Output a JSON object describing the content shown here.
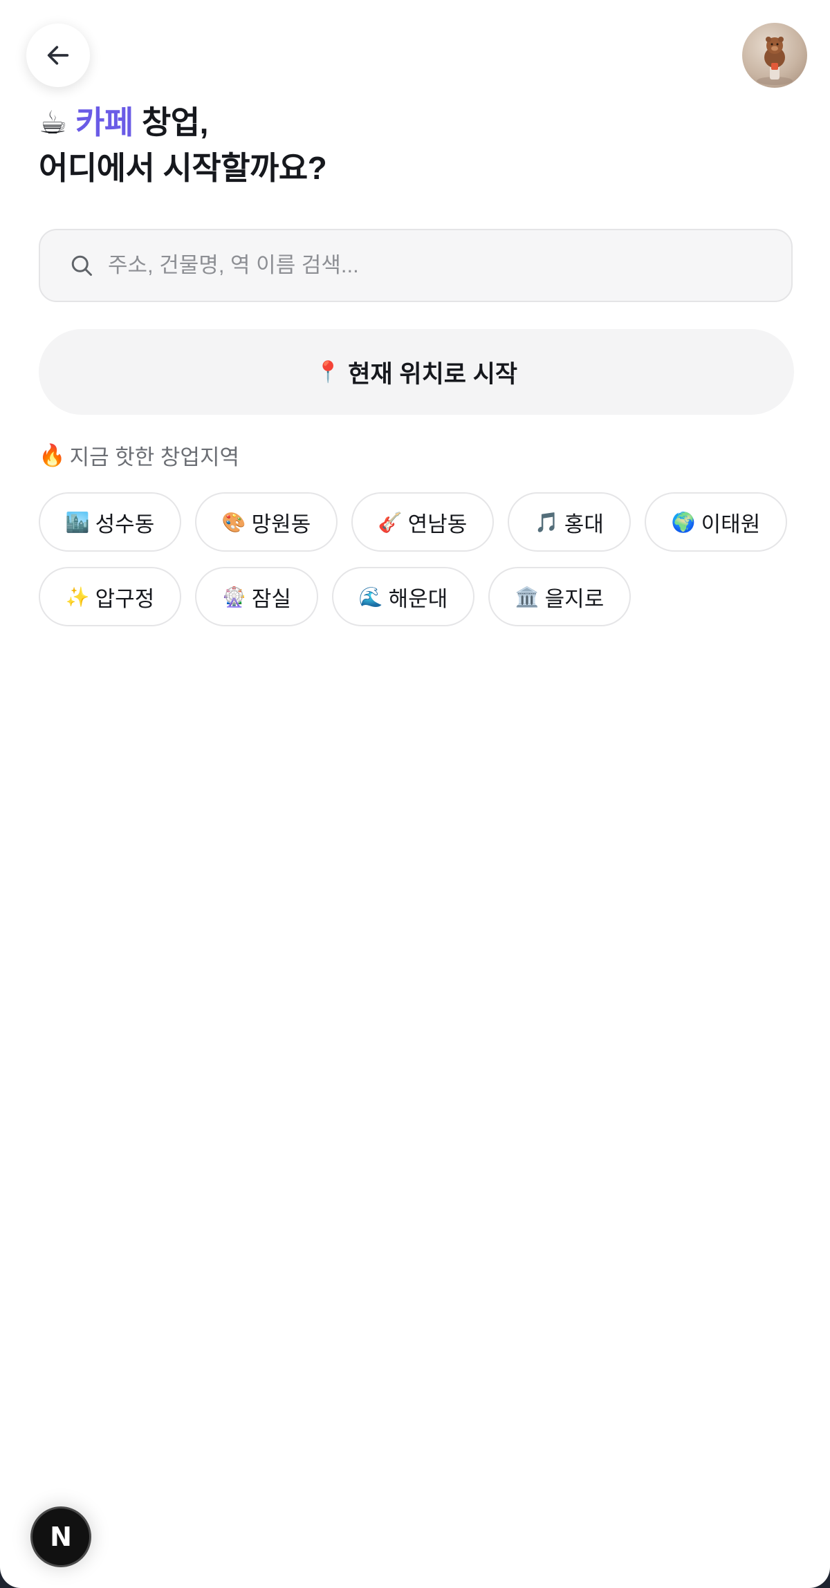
{
  "header": {
    "back_icon": "arrow-left-icon",
    "avatar_icon": "user-avatar"
  },
  "headline": {
    "emoji": "☕",
    "accent": "카페",
    "rest_line1": " 창업,",
    "line2": "어디에서 시작할까요?",
    "accent_color": "#6a5be6"
  },
  "search": {
    "placeholder": "주소, 건물명, 역 이름 검색...",
    "value": ""
  },
  "location_button": {
    "emoji": "📍",
    "label": "현재 위치로 시작"
  },
  "hot_areas": {
    "emoji": "🔥",
    "label": "지금 핫한 창업지역",
    "chips": [
      {
        "emoji": "🏙️",
        "label": "성수동"
      },
      {
        "emoji": "🎨",
        "label": "망원동"
      },
      {
        "emoji": "🎸",
        "label": "연남동"
      },
      {
        "emoji": "🎵",
        "label": "홍대"
      },
      {
        "emoji": "🌍",
        "label": "이태원"
      },
      {
        "emoji": "✨",
        "label": "압구정"
      },
      {
        "emoji": "🎡",
        "label": "잠실"
      },
      {
        "emoji": "🌊",
        "label": "해운대"
      },
      {
        "emoji": "🏛️",
        "label": "을지로"
      }
    ]
  },
  "dev_badge": {
    "label": "N"
  }
}
